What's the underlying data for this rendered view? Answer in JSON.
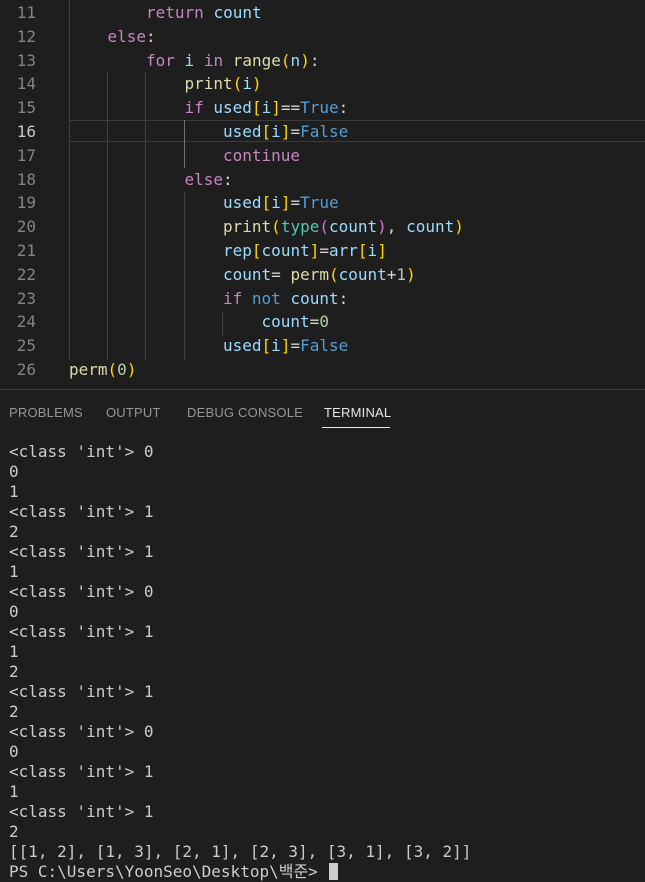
{
  "editor": {
    "active_line": 16,
    "lines": [
      {
        "num": "11",
        "segments": [
          {
            "t": "return",
            "c": "kw"
          },
          {
            "t": " "
          },
          {
            "t": "count",
            "c": "vr"
          }
        ]
      },
      {
        "num": "12",
        "segments": [
          {
            "t": "else",
            "c": "kw"
          },
          {
            "t": ":",
            "c": "op"
          }
        ]
      },
      {
        "num": "13",
        "segments": [
          {
            "t": "for",
            "c": "kw"
          },
          {
            "t": " "
          },
          {
            "t": "i",
            "c": "vr"
          },
          {
            "t": " "
          },
          {
            "t": "in",
            "c": "kw"
          },
          {
            "t": " "
          },
          {
            "t": "range",
            "c": "fn"
          },
          {
            "t": "(",
            "c": "b1"
          },
          {
            "t": "n",
            "c": "vr"
          },
          {
            "t": ")",
            "c": "b1"
          },
          {
            "t": ":",
            "c": "op"
          }
        ]
      },
      {
        "num": "14",
        "segments": [
          {
            "t": "print",
            "c": "fn"
          },
          {
            "t": "(",
            "c": "b1"
          },
          {
            "t": "i",
            "c": "vr"
          },
          {
            "t": ")",
            "c": "b1"
          }
        ]
      },
      {
        "num": "15",
        "segments": [
          {
            "t": "if",
            "c": "kw"
          },
          {
            "t": " "
          },
          {
            "t": "used",
            "c": "vr"
          },
          {
            "t": "[",
            "c": "b1"
          },
          {
            "t": "i",
            "c": "vr"
          },
          {
            "t": "]",
            "c": "b1"
          },
          {
            "t": "==",
            "c": "op"
          },
          {
            "t": "True",
            "c": "cn"
          },
          {
            "t": ":",
            "c": "op"
          }
        ]
      },
      {
        "num": "16",
        "segments": [
          {
            "t": "used",
            "c": "vr"
          },
          {
            "t": "[",
            "c": "b1"
          },
          {
            "t": "i",
            "c": "vr"
          },
          {
            "t": "]",
            "c": "b1"
          },
          {
            "t": "=",
            "c": "op"
          },
          {
            "t": "False",
            "c": "cn"
          }
        ]
      },
      {
        "num": "17",
        "segments": [
          {
            "t": "continue",
            "c": "kw"
          }
        ]
      },
      {
        "num": "18",
        "segments": [
          {
            "t": "else",
            "c": "kw"
          },
          {
            "t": ":",
            "c": "op"
          }
        ]
      },
      {
        "num": "19",
        "segments": [
          {
            "t": "used",
            "c": "vr"
          },
          {
            "t": "[",
            "c": "b1"
          },
          {
            "t": "i",
            "c": "vr"
          },
          {
            "t": "]",
            "c": "b1"
          },
          {
            "t": "=",
            "c": "op"
          },
          {
            "t": "True",
            "c": "cn"
          }
        ]
      },
      {
        "num": "20",
        "segments": [
          {
            "t": "print",
            "c": "fn"
          },
          {
            "t": "(",
            "c": "b1"
          },
          {
            "t": "type",
            "c": "bi"
          },
          {
            "t": "(",
            "c": "b2"
          },
          {
            "t": "count",
            "c": "vr"
          },
          {
            "t": ")",
            "c": "b2"
          },
          {
            "t": ", ",
            "c": "op"
          },
          {
            "t": "count",
            "c": "vr"
          },
          {
            "t": ")",
            "c": "b1"
          }
        ]
      },
      {
        "num": "21",
        "segments": [
          {
            "t": "rep",
            "c": "vr"
          },
          {
            "t": "[",
            "c": "b1"
          },
          {
            "t": "count",
            "c": "vr"
          },
          {
            "t": "]",
            "c": "b1"
          },
          {
            "t": "=",
            "c": "op"
          },
          {
            "t": "arr",
            "c": "vr"
          },
          {
            "t": "[",
            "c": "b1"
          },
          {
            "t": "i",
            "c": "vr"
          },
          {
            "t": "]",
            "c": "b1"
          }
        ]
      },
      {
        "num": "22",
        "segments": [
          {
            "t": "count",
            "c": "vr"
          },
          {
            "t": "= ",
            "c": "op"
          },
          {
            "t": "perm",
            "c": "fn"
          },
          {
            "t": "(",
            "c": "b1"
          },
          {
            "t": "count",
            "c": "vr"
          },
          {
            "t": "+",
            "c": "op"
          },
          {
            "t": "1",
            "c": "nm"
          },
          {
            "t": ")",
            "c": "b1"
          }
        ]
      },
      {
        "num": "23",
        "segments": [
          {
            "t": "if",
            "c": "kw"
          },
          {
            "t": " "
          },
          {
            "t": "not",
            "c": "kb"
          },
          {
            "t": " "
          },
          {
            "t": "count",
            "c": "vr"
          },
          {
            "t": ":",
            "c": "op"
          }
        ]
      },
      {
        "num": "24",
        "segments": [
          {
            "t": "count",
            "c": "vr"
          },
          {
            "t": "=",
            "c": "op"
          },
          {
            "t": "0",
            "c": "nm"
          }
        ]
      },
      {
        "num": "25",
        "segments": [
          {
            "t": "used",
            "c": "vr"
          },
          {
            "t": "[",
            "c": "b1"
          },
          {
            "t": "i",
            "c": "vr"
          },
          {
            "t": "]",
            "c": "b1"
          },
          {
            "t": "=",
            "c": "op"
          },
          {
            "t": "False",
            "c": "cn"
          }
        ]
      },
      {
        "num": "26",
        "segments": [
          {
            "t": "perm",
            "c": "fn"
          },
          {
            "t": "(",
            "c": "b1"
          },
          {
            "t": "0",
            "c": "nm"
          },
          {
            "t": ")",
            "c": "b1"
          }
        ]
      }
    ]
  },
  "panel": {
    "tabs": [
      {
        "label": "PROBLEMS",
        "active": false
      },
      {
        "label": "OUTPUT",
        "active": false
      },
      {
        "label": "DEBUG CONSOLE",
        "active": false
      },
      {
        "label": "TERMINAL",
        "active": true
      }
    ],
    "terminal_lines": [
      "<class 'int'> 0",
      "0",
      "1",
      "<class 'int'> 1",
      "2",
      "<class 'int'> 1",
      "1",
      "<class 'int'> 0",
      "0",
      "<class 'int'> 1",
      "1",
      "2",
      "<class 'int'> 1",
      "2",
      "<class 'int'> 0",
      "0",
      "<class 'int'> 1",
      "1",
      "<class 'int'> 1",
      "2",
      "[[1, 2], [1, 3], [2, 1], [2, 3], [3, 1], [3, 2]]",
      "PS C:\\Users\\YoonSeo\\Desktop\\백준>"
    ]
  }
}
